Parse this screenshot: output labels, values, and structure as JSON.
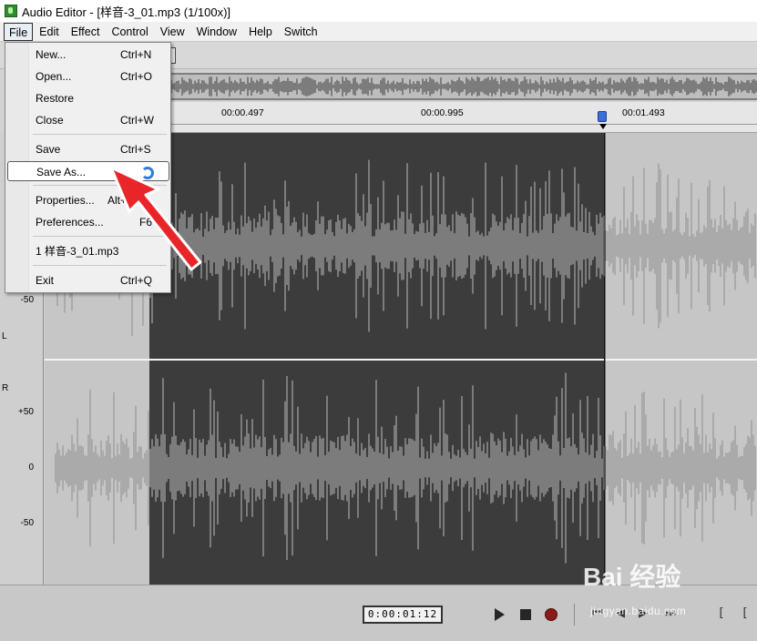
{
  "window": {
    "title": "Audio Editor - [样音-3_01.mp3 (1/100x)]"
  },
  "menubar": {
    "items": [
      "File",
      "Edit",
      "Effect",
      "Control",
      "View",
      "Window",
      "Help",
      "Switch"
    ]
  },
  "file_menu": {
    "items": [
      {
        "label": "New...",
        "shortcut": "Ctrl+N"
      },
      {
        "label": "Open...",
        "shortcut": "Ctrl+O"
      },
      {
        "label": "Restore",
        "shortcut": ""
      },
      {
        "label": "Close",
        "shortcut": "Ctrl+W"
      },
      {
        "label": "Save",
        "shortcut": "Ctrl+S"
      },
      {
        "label": "Save As...",
        "shortcut": ""
      },
      {
        "label": "Properties...",
        "shortcut": "Alt+"
      },
      {
        "label": "Preferences...",
        "shortcut": "F6"
      },
      {
        "label": "1 样音-3_01.mp3",
        "shortcut": ""
      },
      {
        "label": "Exit",
        "shortcut": "Ctrl+Q"
      }
    ],
    "highlighted": "Save As..."
  },
  "timeline": {
    "ticks": [
      "00:00.497",
      "00:00.995",
      "00:01.493"
    ]
  },
  "ruler": {
    "left_labels": [
      "-50"
    ],
    "left_channel": "L",
    "right_channel": "R",
    "right_labels": [
      "+50",
      "0",
      "-50"
    ]
  },
  "transport": {
    "time_display": "0:00:01:12"
  },
  "watermark": {
    "logo": "Bai 经验",
    "site": "jingyan.baidu.com"
  },
  "colors": {
    "selection": "#3c3c3c",
    "waveform_light": "#8f8f8f",
    "waveform_on_selection": "#bdbdbd",
    "arrow": "#e8262a"
  }
}
